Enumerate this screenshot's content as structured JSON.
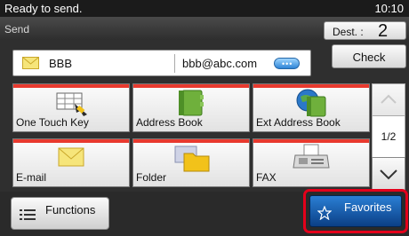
{
  "status": {
    "text": "Ready to send.",
    "time": "10:10"
  },
  "header": {
    "title": "Send",
    "dest_label": "Dest. :",
    "dest_count": "2"
  },
  "destination": {
    "name": "BBB",
    "address": "bbb@abc.com",
    "more_icon": "more-icon"
  },
  "check_button": {
    "label": "Check"
  },
  "tiles": [
    {
      "label": "One Touch Key",
      "icon": "one-touch-key-icon"
    },
    {
      "label": "Address Book",
      "icon": "address-book-icon"
    },
    {
      "label": "Ext Address Book",
      "icon": "ext-address-book-icon"
    },
    {
      "label": "E-mail",
      "icon": "email-icon"
    },
    {
      "label": "Folder",
      "icon": "folder-icon"
    },
    {
      "label": "FAX",
      "icon": "fax-icon"
    }
  ],
  "pager": {
    "page": "1/2"
  },
  "functions_button": {
    "label": "Functions"
  },
  "favorites_button": {
    "label": "Favorites"
  },
  "colors": {
    "accent_red": "#e8392e",
    "highlight_red": "#e4001b",
    "favorites_blue": "#1b5fb0"
  }
}
